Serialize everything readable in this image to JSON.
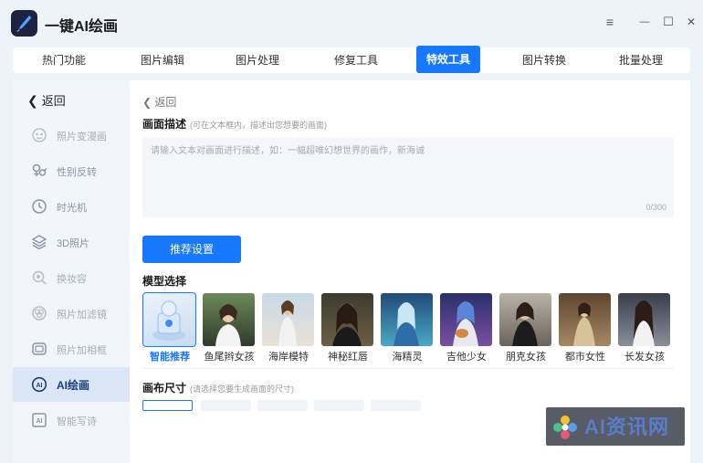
{
  "app": {
    "title": "一键AI绘画"
  },
  "window_controls": {
    "menu": "≡",
    "minimize": "—",
    "maximize": "☐",
    "close": "✕"
  },
  "tabs": [
    "热门功能",
    "图片编辑",
    "图片处理",
    "修复工具",
    "特效工具",
    "图片转换",
    "批量处理"
  ],
  "active_tab": "特效工具",
  "sidebar": {
    "back_label": "返回",
    "items": [
      {
        "label": "照片变漫画",
        "icon": "cartoon-face-icon"
      },
      {
        "label": "性别反转",
        "icon": "gender-icon"
      },
      {
        "label": "时光机",
        "icon": "clock-icon"
      },
      {
        "label": "3D照片",
        "icon": "layers-icon"
      },
      {
        "label": "换妆容",
        "icon": "makeup-icon"
      },
      {
        "label": "照片加滤镜",
        "icon": "filter-icon"
      },
      {
        "label": "照片加相框",
        "icon": "frame-icon"
      },
      {
        "label": "AI绘画",
        "icon": "ai-icon"
      },
      {
        "label": "智能写诗",
        "icon": "ai-poem-icon"
      }
    ],
    "active_item": "AI绘画"
  },
  "main": {
    "back_label": "返回",
    "description": {
      "title": "画面描述",
      "hint": "(可在文本框内，描述出您想要的画面)",
      "placeholder": "请输入文本对画面进行描述，如：一幅超唯幻想世界的画作，新海诚",
      "counter": "0/300"
    },
    "recommend_button": "推荐设置",
    "model": {
      "title": "模型选择",
      "options": [
        {
          "label": "智能推荐",
          "selected": true
        },
        {
          "label": "鱼尾辫女孩"
        },
        {
          "label": "海岸模特"
        },
        {
          "label": "神秘红唇"
        },
        {
          "label": "海精灵"
        },
        {
          "label": "吉他少女"
        },
        {
          "label": "朋克女孩"
        },
        {
          "label": "都市女性"
        },
        {
          "label": "长发女孩"
        }
      ]
    },
    "canvas": {
      "title": "画布尺寸",
      "hint": "(请选择您要生成画面的尺寸)"
    }
  },
  "watermark": {
    "text": "AI资讯网"
  },
  "colors": {
    "accent": "#1677ff",
    "sidebar_active": "#dbe7f7",
    "background": "#eef3fa"
  }
}
